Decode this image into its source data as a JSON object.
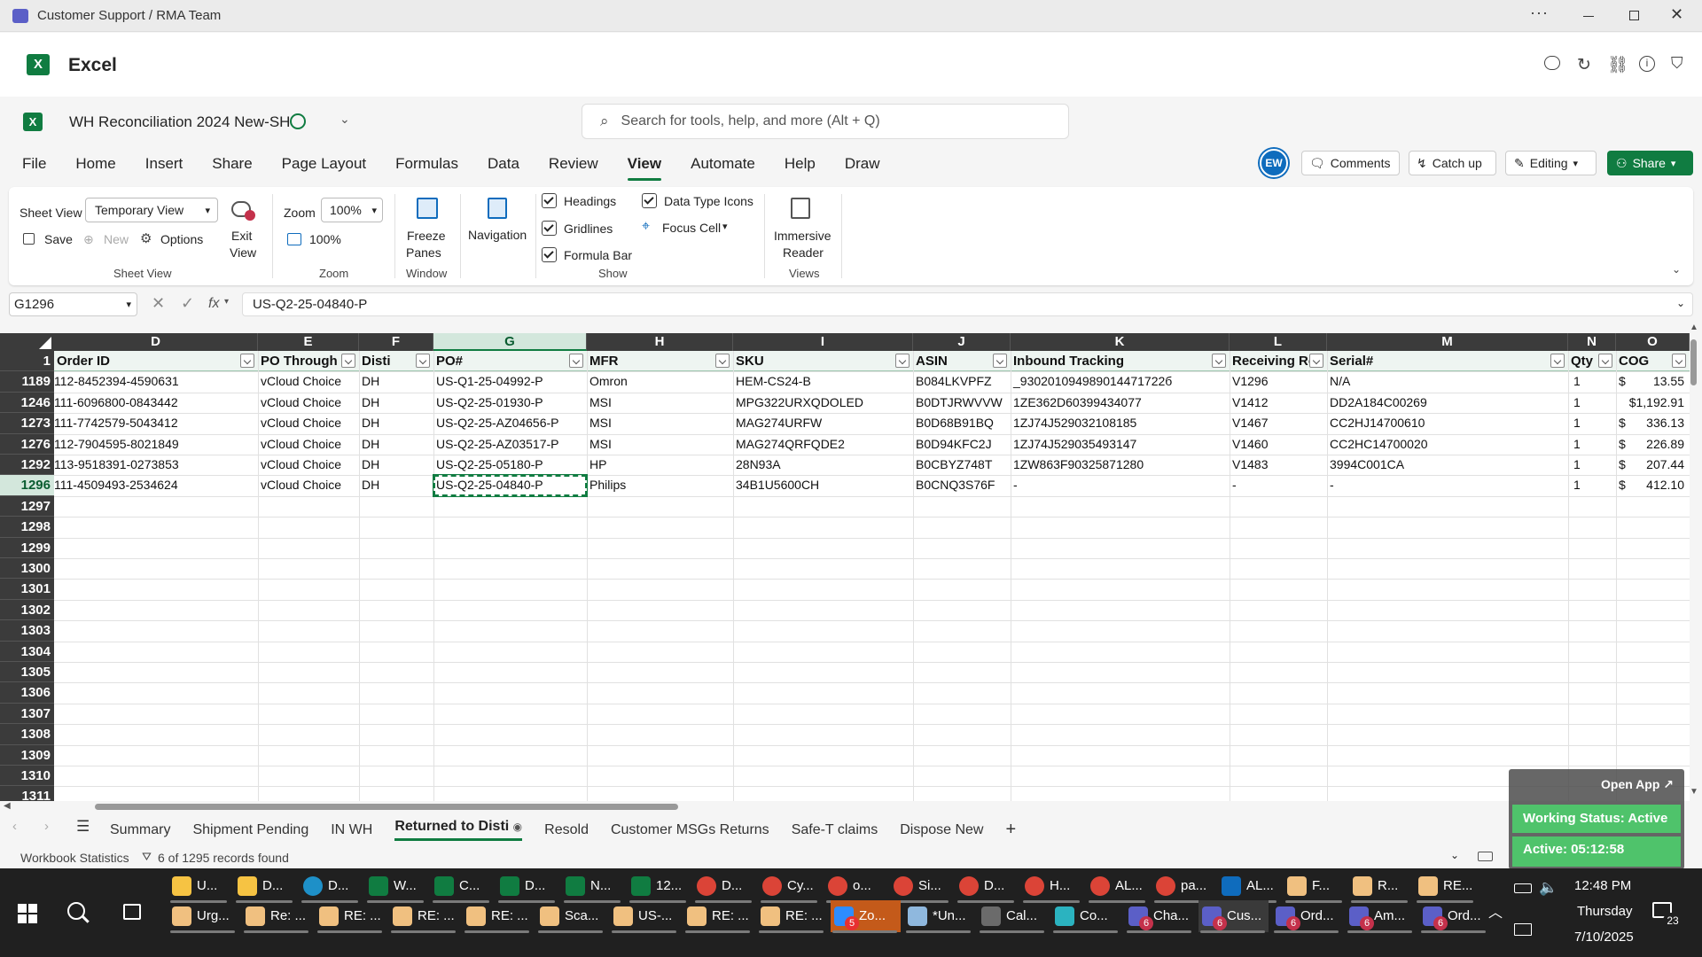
{
  "window": {
    "title": "Customer Support / RMA Team"
  },
  "app": {
    "name": "Excel"
  },
  "doc": {
    "name": "WH Reconciliation 2024 New-SH",
    "search_placeholder": "Search for tools, help, and more (Alt + Q)"
  },
  "tabs": [
    "File",
    "Home",
    "Insert",
    "Share",
    "Page Layout",
    "Formulas",
    "Data",
    "Review",
    "View",
    "Automate",
    "Help",
    "Draw"
  ],
  "active_tab": "View",
  "user": {
    "initials": "EW"
  },
  "actions": {
    "comments": "Comments",
    "catchup": "Catch up",
    "editing": "Editing",
    "share": "Share"
  },
  "ribbon": {
    "sheet_view": {
      "label": "Sheet View",
      "select": "Temporary View",
      "save": "Save",
      "new": "New",
      "options": "Options",
      "exit1": "Exit",
      "exit2": "View",
      "group": "Sheet View"
    },
    "zoom": {
      "label": "Zoom",
      "select": "100%",
      "reset": "100%",
      "group": "Zoom"
    },
    "window": {
      "freeze1": "Freeze",
      "freeze2": "Panes",
      "group": "Window"
    },
    "navigation": {
      "label": "Navigation"
    },
    "show": {
      "headings": "Headings",
      "gridlines": "Gridlines",
      "formula_bar": "Formula Bar",
      "data_type_icons": "Data Type Icons",
      "focus_cell": "Focus Cell",
      "group": "Show"
    },
    "views": {
      "immersive1": "Immersive",
      "immersive2": "Reader",
      "group": "Views"
    }
  },
  "formula_bar": {
    "name_box": "G1296",
    "fx": "fx",
    "value": "US-Q2-25-04840-P"
  },
  "columns": [
    {
      "letter": "D"
    },
    {
      "letter": "E"
    },
    {
      "letter": "F"
    },
    {
      "letter": "G"
    },
    {
      "letter": "H"
    },
    {
      "letter": "I"
    },
    {
      "letter": "J"
    },
    {
      "letter": "K"
    },
    {
      "letter": "L"
    },
    {
      "letter": "M"
    },
    {
      "letter": "N"
    },
    {
      "letter": "O"
    }
  ],
  "header_row": {
    "num": "1",
    "cells": [
      "Order ID",
      "PO Through",
      "Disti",
      "PO#",
      "MFR",
      "SKU",
      "ASIN",
      "Inbound Tracking",
      "Receiving Re",
      "Serial#",
      "Qty",
      "COG"
    ]
  },
  "rows": [
    {
      "num": "1189",
      "cells": [
        "112-8452394-4590631",
        "vCloud Choice",
        "DH",
        "US-Q1-25-04992-P",
        "Omron",
        "HEM-CS24-B",
        "B084LKVPFZ",
        "_930201094989014471722б",
        "V1296",
        "N/A",
        "1",
        "$",
        "13.55"
      ]
    },
    {
      "num": "1246",
      "cells": [
        "111-6096800-0843442",
        "vCloud Choice",
        "DH",
        "US-Q2-25-01930-P",
        "MSI",
        "MPG322URXQDOLED",
        "B0DTJRWVVW",
        "1ZE362D60399434077",
        "V1412",
        "DD2A184C00269",
        "1",
        "$1,192.91",
        ""
      ]
    },
    {
      "num": "1273",
      "cells": [
        "111-7742579-5043412",
        "vCloud Choice",
        "DH",
        "US-Q2-25-AZ04656-P",
        "MSI",
        "MAG274URFW",
        "B0D68B91BQ",
        "1ZJ74J529032108185",
        "V1467",
        "CC2HJ14700610",
        "1",
        "$",
        "336.13"
      ]
    },
    {
      "num": "1276",
      "cells": [
        "112-7904595-8021849",
        "vCloud Choice",
        "DH",
        "US-Q2-25-AZ03517-P",
        "MSI",
        "MAG274QRFQDE2",
        "B0D94KFC2J",
        "1ZJ74J529035493147",
        "V1460",
        "CC2HC14700020",
        "1",
        "$",
        "226.89"
      ]
    },
    {
      "num": "1292",
      "cells": [
        "113-9518391-0273853",
        "vCloud Choice",
        "DH",
        "US-Q2-25-05180-P",
        "HP",
        "28N93A",
        "B0CBYZ748T",
        "1ZW863F90325871280",
        "V1483",
        " 3994C001CA",
        "1",
        "$",
        "207.44"
      ]
    },
    {
      "num": "1296",
      "cells": [
        "111-4509493-2534624",
        "vCloud Choice",
        "DH",
        "US-Q2-25-04840-P",
        "Philips",
        "34B1U5600CH",
        "B0CNQ3S76F",
        "-",
        "-",
        "-",
        "1",
        "$",
        "412.10"
      ]
    }
  ],
  "empty_rows": [
    "1297",
    "1298",
    "1299",
    "1300",
    "1301",
    "1302",
    "1303",
    "1304",
    "1305",
    "1306",
    "1307",
    "1308",
    "1309",
    "1310",
    "1311"
  ],
  "sheets": [
    "Summary",
    "Shipment Pending",
    "IN WH",
    "Returned to Disti",
    "Resold",
    "Customer MSGs Returns",
    "Safe-T claims",
    "Dispose New"
  ],
  "active_sheet": "Returned to Disti",
  "status": {
    "workbook_stats": "Workbook Statistics",
    "records": "6 of 1295 records found",
    "zoom": "100%"
  },
  "overlay": {
    "open_app": "Open App ↗",
    "working_status": "Working Status: Active",
    "active_timer": "Active: 05:12:58"
  },
  "taskbar": {
    "row1": [
      {
        "icon": "folder",
        "label": "U...",
        "color": "#f6c343"
      },
      {
        "icon": "folder-doc",
        "label": "D...",
        "color": "#f6c343"
      },
      {
        "icon": "edge",
        "label": "D...",
        "color": "#1e90c8"
      },
      {
        "icon": "excel",
        "label": "W...",
        "color": "#107c41"
      },
      {
        "icon": "excel",
        "label": "C...",
        "color": "#107c41"
      },
      {
        "icon": "excel",
        "label": "D...",
        "color": "#107c41"
      },
      {
        "icon": "excel",
        "label": "N...",
        "color": "#107c41"
      },
      {
        "icon": "excel",
        "label": "12...",
        "color": "#107c41"
      },
      {
        "icon": "chrome",
        "label": "D...",
        "color": "#db4437"
      },
      {
        "icon": "chrome",
        "label": "Cy...",
        "color": "#db4437"
      },
      {
        "icon": "chrome",
        "label": "o...",
        "color": "#db4437"
      },
      {
        "icon": "chrome",
        "label": "Si...",
        "color": "#db4437"
      },
      {
        "icon": "chrome",
        "label": "D...",
        "color": "#db4437"
      },
      {
        "icon": "chrome",
        "label": "H...",
        "color": "#db4437"
      },
      {
        "icon": "chrome",
        "label": "AL...",
        "color": "#db4437"
      },
      {
        "icon": "chrome",
        "label": "pa...",
        "color": "#db4437"
      },
      {
        "icon": "outlook",
        "label": "AL...",
        "color": "#0f6cbd"
      },
      {
        "icon": "mail",
        "label": "F...",
        "color": "#f0c080"
      },
      {
        "icon": "mail",
        "label": "R...",
        "color": "#f0c080"
      },
      {
        "icon": "mail",
        "label": "RE...",
        "color": "#f0c080"
      }
    ],
    "row2": [
      {
        "icon": "mail",
        "label": "Urg...",
        "color": "#f0c080"
      },
      {
        "icon": "mail",
        "label": "Re: ...",
        "color": "#f0c080"
      },
      {
        "icon": "mail",
        "label": "RE: ...",
        "color": "#f0c080"
      },
      {
        "icon": "mail",
        "label": "RE: ...",
        "color": "#f0c080"
      },
      {
        "icon": "mail",
        "label": "RE: ...",
        "color": "#f0c080"
      },
      {
        "icon": "mail",
        "label": "Sca...",
        "color": "#f0c080"
      },
      {
        "icon": "mail",
        "label": "US-...",
        "color": "#f0c080"
      },
      {
        "icon": "mail",
        "label": "RE: ...",
        "color": "#f0c080"
      },
      {
        "icon": "mail",
        "label": "RE: ...",
        "color": "#f0c080"
      },
      {
        "icon": "zoom",
        "label": "Zo...",
        "color": "#2d8cff"
      },
      {
        "icon": "notepad",
        "label": "*Un...",
        "color": "#8fb8de"
      },
      {
        "icon": "calc",
        "label": "Cal...",
        "color": "#6b6b6b"
      },
      {
        "icon": "copilot",
        "label": "Co...",
        "color": "#2bb3c0"
      },
      {
        "icon": "teams",
        "label": "Cha...",
        "color": "#5b5fc7"
      },
      {
        "icon": "teams",
        "label": "Cus...",
        "color": "#5b5fc7"
      },
      {
        "icon": "teams",
        "label": "Ord...",
        "color": "#5b5fc7"
      },
      {
        "icon": "teams",
        "label": "Am...",
        "color": "#5b5fc7"
      },
      {
        "icon": "teams",
        "label": "Ord...",
        "color": "#5b5fc7"
      }
    ],
    "zoom_badge": "5",
    "teams_badge": "6",
    "clock": {
      "time": "12:48 PM",
      "day": "Thursday",
      "date": "7/10/2025"
    },
    "notif_count": "23"
  },
  "colors": {
    "excel_green": "#107c41",
    "grid_header": "#3b3b3b",
    "selection_green": "#d3e7dc",
    "taskbar": "#202020",
    "status_green": "#4fc36b"
  }
}
